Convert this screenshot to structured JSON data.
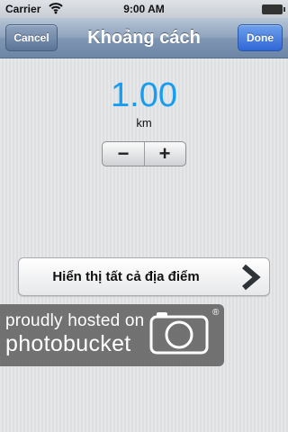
{
  "status_bar": {
    "carrier": "Carrier",
    "time": "9:00 AM",
    "icons": [
      "wifi-icon",
      "battery-icon"
    ]
  },
  "nav": {
    "title": "Khoảng cách",
    "cancel_label": "Cancel",
    "done_label": "Done"
  },
  "distance": {
    "value": "1.00",
    "unit": "km",
    "decrement_label": "−",
    "increment_label": "+"
  },
  "show_all": {
    "label": "Hiển thị tất cả địa điểm",
    "icon": "chevron-right-icon"
  },
  "watermark": {
    "line1": "proudly hosted on",
    "line2": "photobucket",
    "mark": "®"
  },
  "colors": {
    "accent_value": "#169cf0",
    "nav_bar": "#7f96b3",
    "done_button": "#2f67d6"
  }
}
